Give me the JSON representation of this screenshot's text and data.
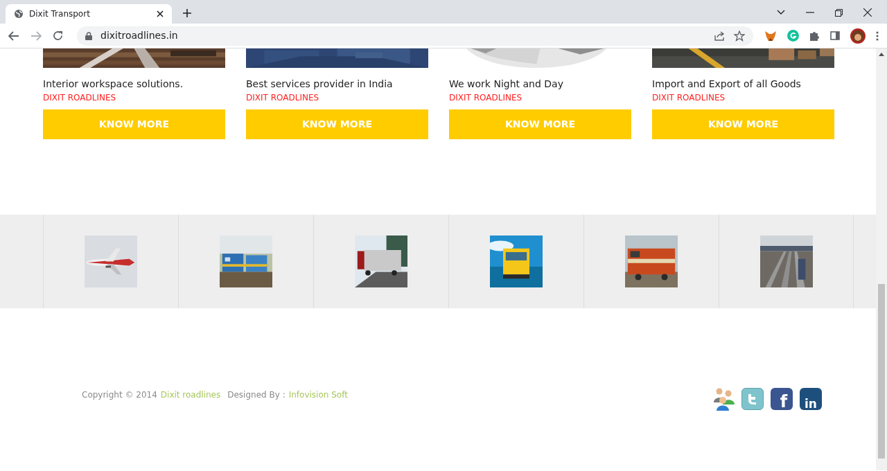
{
  "browser": {
    "tab_title": "Dixit Transport",
    "url": "dixitroadlines.in"
  },
  "cards": [
    {
      "title": "Interior workspace solutions.",
      "subtitle": "DIXIT ROADLINES",
      "button": "KNOW MORE"
    },
    {
      "title": "Best services provider in India",
      "subtitle": "DIXIT ROADLINES",
      "button": "KNOW MORE"
    },
    {
      "title": "We work Night and Day",
      "subtitle": "DIXIT ROADLINES",
      "button": "KNOW MORE"
    },
    {
      "title": "Import and Export of all Goods",
      "subtitle": "DIXIT ROADLINES",
      "button": "KNOW MORE"
    }
  ],
  "footer": {
    "copyright": "Copyright © 2014",
    "company_link": "Dixit roadlines",
    "designed_by": "Designed By :",
    "designer_link": "Infovision Soft"
  },
  "social": [
    {
      "kind": "people"
    },
    {
      "kind": "twitter"
    },
    {
      "kind": "facebook",
      "glyph": "f"
    },
    {
      "kind": "linkedin",
      "glyph": "in"
    }
  ]
}
